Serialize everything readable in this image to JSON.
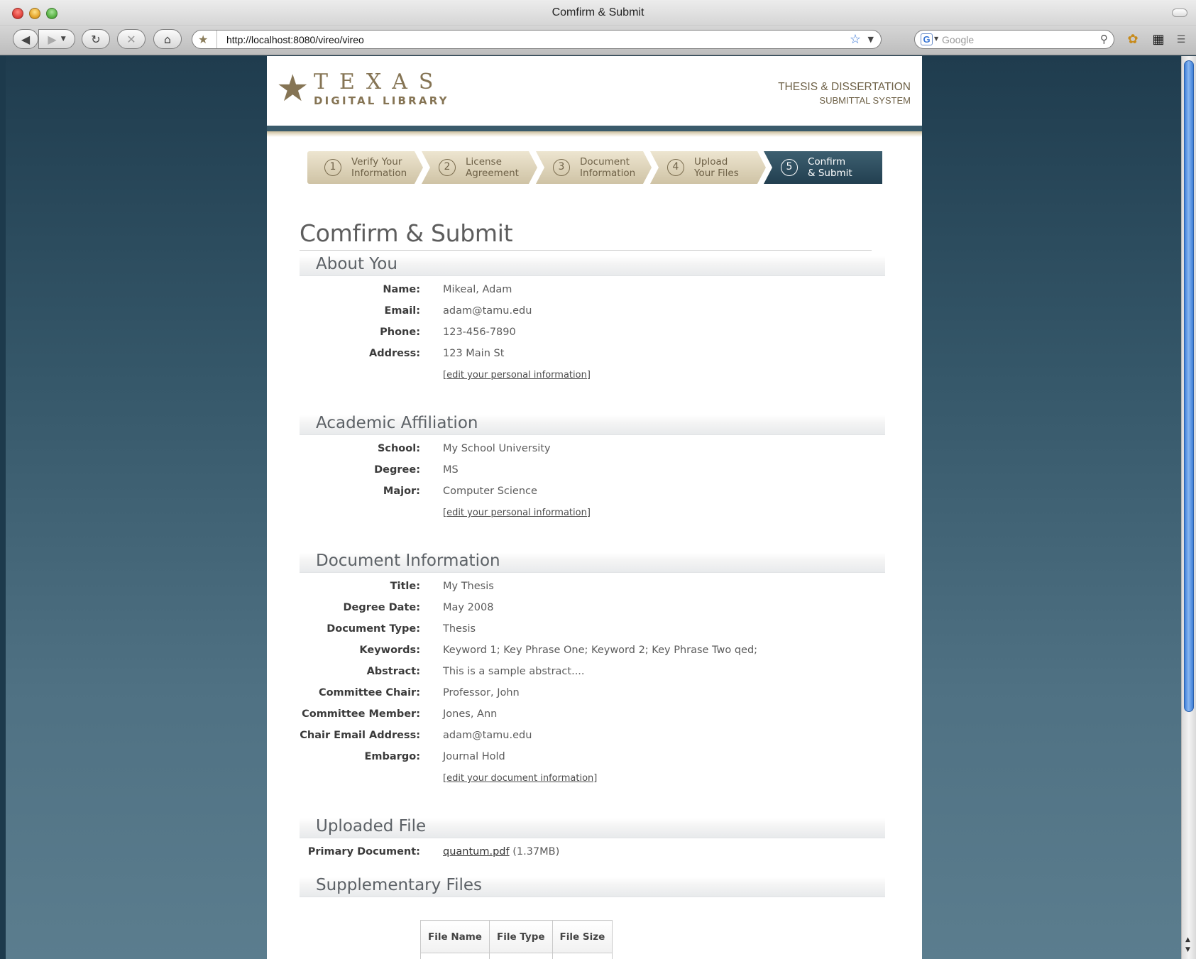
{
  "window": {
    "title": "Comfirm & Submit"
  },
  "browser": {
    "url": "http://localhost:8080/vireo/vireo",
    "search_placeholder": "Google",
    "search_engine_letter": "G"
  },
  "site": {
    "logo_line1": "TEXAS",
    "logo_line2": "DIGITAL LIBRARY",
    "system_title": "THESIS & DISSERTATION",
    "system_subtitle": "SUBMITTAL SYSTEM"
  },
  "steps": [
    {
      "num": "1",
      "line1": "Verify Your",
      "line2": "Information"
    },
    {
      "num": "2",
      "line1": "License",
      "line2": "Agreement"
    },
    {
      "num": "3",
      "line1": "Document",
      "line2": "Information"
    },
    {
      "num": "4",
      "line1": "Upload",
      "line2": "Your Files"
    },
    {
      "num": "5",
      "line1": "Confirm",
      "line2": "& Submit"
    }
  ],
  "page": {
    "title": "Comfirm & Submit"
  },
  "about": {
    "heading": "About You",
    "name_label": "Name:",
    "name": "Mikeal, Adam",
    "email_label": "Email:",
    "email": "adam@tamu.edu",
    "phone_label": "Phone:",
    "phone": "123-456-7890",
    "address_label": "Address:",
    "address": "123 Main St",
    "edit_link": "[edit your personal information]"
  },
  "academic": {
    "heading": "Academic Affiliation",
    "school_label": "School:",
    "school": "My School University",
    "degree_label": "Degree:",
    "degree": "MS",
    "major_label": "Major:",
    "major": "Computer Science",
    "edit_link": "[edit your personal information]"
  },
  "document": {
    "heading": "Document Information",
    "title_label": "Title:",
    "title": "My Thesis",
    "degree_date_label": "Degree Date:",
    "degree_date": "May 2008",
    "type_label": "Document Type:",
    "type": "Thesis",
    "keywords_label": "Keywords:",
    "keywords": "Keyword 1; Key Phrase One; Keyword 2; Key Phrase Two qed;",
    "abstract_label": "Abstract:",
    "abstract": "This is a sample abstract....",
    "chair_label": "Committee Chair:",
    "chair": "Professor, John",
    "member_label": "Committee Member:",
    "member": "Jones, Ann",
    "chair_email_label": "Chair Email Address:",
    "chair_email": "adam@tamu.edu",
    "embargo_label": "Embargo:",
    "embargo": "Journal Hold",
    "edit_link": "[edit your document information]"
  },
  "uploaded": {
    "heading": "Uploaded File",
    "primary_label": "Primary Document:",
    "primary_file": "quantum.pdf",
    "primary_size": "(1.37MB)"
  },
  "supplementary": {
    "heading": "Supplementary Files",
    "columns": [
      "File Name",
      "File Type",
      "File Size"
    ]
  }
}
